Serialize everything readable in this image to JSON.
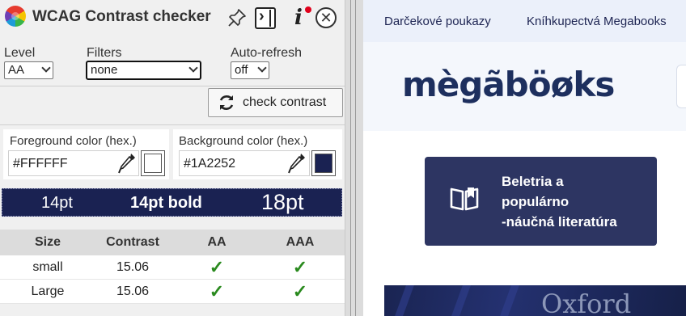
{
  "panel": {
    "title": "WCAG Contrast checker",
    "icons": [
      "pin-icon",
      "sidebar-toggle-icon",
      "info-icon",
      "close-icon"
    ],
    "level": {
      "label": "Level",
      "value": "AA"
    },
    "filters": {
      "label": "Filters",
      "value": "none"
    },
    "autorefresh": {
      "label": "Auto-refresh",
      "value": "off"
    },
    "check_button": "check contrast",
    "foreground": {
      "label": "Foreground color (hex.)",
      "value": "#FFFFFF",
      "color": "#FFFFFF"
    },
    "background": {
      "label": "Background color (hex.)",
      "value": "#1A2252",
      "color": "#1A2252"
    },
    "preview": {
      "small": "14pt",
      "bold": "14pt bold",
      "large": "18pt"
    },
    "table": {
      "headers": [
        "Size",
        "Contrast",
        "AA",
        "AAA"
      ],
      "rows": [
        {
          "size": "small",
          "contrast": "15.06",
          "aa": "✓",
          "aaa": "✓"
        },
        {
          "size": "Large",
          "contrast": "15.06",
          "aa": "✓",
          "aaa": "✓"
        }
      ]
    },
    "colors": {
      "pass": "#2a8a1e",
      "notify_dot": "#e0001b"
    }
  },
  "site": {
    "nav": [
      "Darčekové poukazy",
      "Kníhkupectvá Megabooks"
    ],
    "logo_text": "mègãböøks",
    "category": {
      "line1": "Beletria a",
      "line2": "populárno",
      "line3": "-náučná literatúra",
      "icon": "open-book-icon"
    },
    "banner_text": "Oxford",
    "colors": {
      "brand": "#1d2f5e",
      "card": "#2d3562",
      "nav_bg": "#ebf0fa"
    }
  }
}
